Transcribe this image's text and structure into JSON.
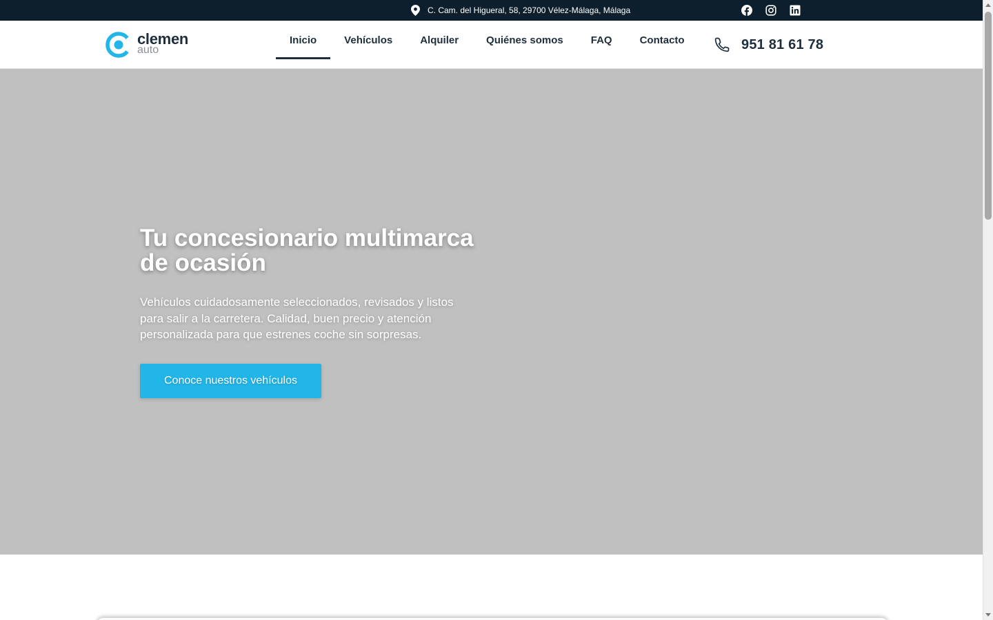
{
  "topbar": {
    "address": "C. Cam. del Higueral, 58, 29700 Vélez-Málaga, Málaga",
    "address_icon": "map-pin-icon",
    "socials": [
      {
        "name": "facebook-icon"
      },
      {
        "name": "instagram-icon"
      },
      {
        "name": "linkedin-icon"
      }
    ],
    "background": "#0d1f2d"
  },
  "header": {
    "logo": {
      "word1": "clemen",
      "word2": "auto",
      "color": "#22b5e8"
    },
    "nav": [
      {
        "label": "Inicio",
        "active": true
      },
      {
        "label": "Vehículos",
        "active": false
      },
      {
        "label": "Alquiler",
        "active": false
      },
      {
        "label": "Quiénes somos",
        "active": false
      },
      {
        "label": "FAQ",
        "active": false
      },
      {
        "label": "Contacto",
        "active": false
      }
    ],
    "phone": {
      "icon": "phone-icon",
      "number": "951 81 61 78"
    }
  },
  "hero": {
    "title": "Tu concesionario multimarca de ocasión",
    "description": "Vehículos cuidadosamente seleccionados, revisados y listos para salir a la carretera. Calidad, buen precio y atención personalizada para que estrenes coche sin sorpresas.",
    "cta_label": "Conoce nuestros vehículos",
    "background": "#c0c0c0",
    "cta_color": "#22b5e8"
  }
}
